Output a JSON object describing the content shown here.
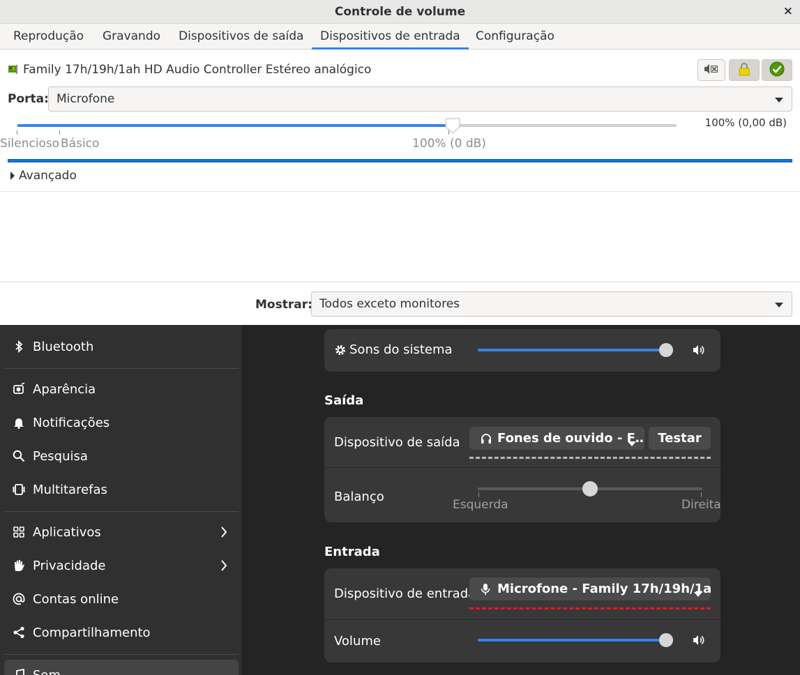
{
  "volume_control": {
    "title": "Controle de volume",
    "close_glyph": "×",
    "tabs": [
      {
        "label": "Reprodução"
      },
      {
        "label": "Gravando"
      },
      {
        "label": "Dispositivos de saída"
      },
      {
        "label": "Dispositivos de entrada",
        "active": true
      },
      {
        "label": "Configuração"
      }
    ],
    "device_name": "Family 17h/19h/1ah HD Audio Controller Estéreo analógico",
    "port_label": "Porta:",
    "port_value": "Microfone",
    "volume_readout": "100% (0,00 dB)",
    "volume_level_fraction": 0.66,
    "scale_marks": {
      "silent": "Silencioso",
      "base": "Básico",
      "hundred": "100% (0 dB)"
    },
    "advanced_label": "Avançado",
    "show_label": "Mostrar:",
    "show_value": "Todos exceto monitores",
    "accent_color": "#3584e4"
  },
  "settings": {
    "sidebar": {
      "items": [
        {
          "label": "Bluetooth",
          "icon": "bluetooth-icon"
        },
        {
          "label": "Aparência",
          "icon": "appearance-icon"
        },
        {
          "label": "Notificações",
          "icon": "bell-icon"
        },
        {
          "label": "Pesquisa",
          "icon": "search-icon"
        },
        {
          "label": "Multitarefas",
          "icon": "multitasking-icon"
        },
        {
          "label": "Aplicativos",
          "icon": "apps-icon"
        },
        {
          "label": "Privacidade",
          "icon": "hand-icon"
        },
        {
          "label": "Contas online",
          "icon": "at-icon"
        },
        {
          "label": "Compartilhamento",
          "icon": "share-icon"
        },
        {
          "label": "Som",
          "icon": "music-note-icon"
        }
      ]
    },
    "system_sounds": {
      "label": "Sons do sistema",
      "level_fraction": 1.0
    },
    "output": {
      "section_title": "Saída",
      "device_label": "Dispositivo de saída",
      "device_value": "Fones de ouvido - F…",
      "test_label": "Testar",
      "balance_label": "Balanço",
      "balance_left": "Esquerda",
      "balance_right": "Direita",
      "balance_fraction": 0.5
    },
    "input": {
      "section_title": "Entrada",
      "device_label": "Dispositivo de entrada",
      "device_value": "Microfone - Family 17h/19h/1a…",
      "volume_label": "Volume",
      "volume_fraction": 1.0
    }
  }
}
